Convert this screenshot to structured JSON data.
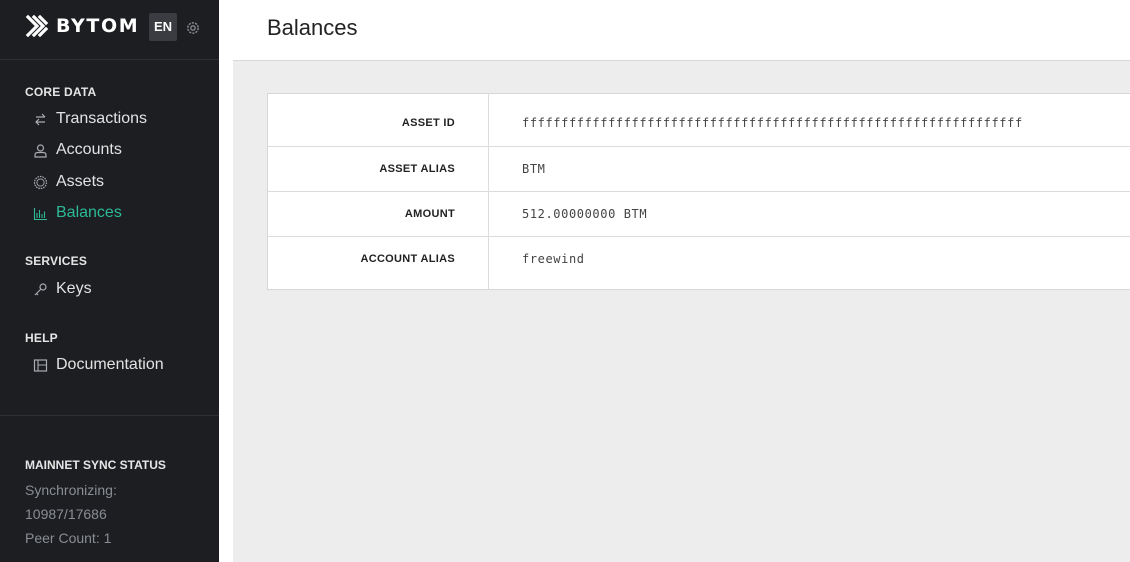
{
  "brand": {
    "name": "BYTOM",
    "language": "EN"
  },
  "sidebar": {
    "sections": [
      {
        "title": "CORE DATA",
        "items": [
          {
            "label": "Transactions",
            "icon": "transactions-icon"
          },
          {
            "label": "Accounts",
            "icon": "user-icon"
          },
          {
            "label": "Assets",
            "icon": "asset-circle-icon"
          },
          {
            "label": "Balances",
            "icon": "bar-chart-icon",
            "active": true
          }
        ]
      },
      {
        "title": "SERVICES",
        "items": [
          {
            "label": "Keys",
            "icon": "key-icon"
          }
        ]
      },
      {
        "title": "HELP",
        "items": [
          {
            "label": "Documentation",
            "icon": "document-icon"
          }
        ]
      }
    ],
    "sync": {
      "title": "MAINNET SYNC STATUS",
      "status": "Synchronizing:",
      "progress": "10987/17686",
      "peers": "Peer Count: 1"
    }
  },
  "main": {
    "title": "Balances",
    "details": [
      {
        "label": "ASSET ID",
        "value": "ffffffffffffffffffffffffffffffffffffffffffffffffffffffffffffffff"
      },
      {
        "label": "ASSET ALIAS",
        "value": "BTM"
      },
      {
        "label": "AMOUNT",
        "value": "512.00000000 BTM"
      },
      {
        "label": "ACCOUNT ALIAS",
        "value": "freewind"
      }
    ]
  },
  "colors": {
    "sidebar_bg": "#1c1e22",
    "accent": "#2dbb95",
    "content_bg": "#ededed"
  }
}
